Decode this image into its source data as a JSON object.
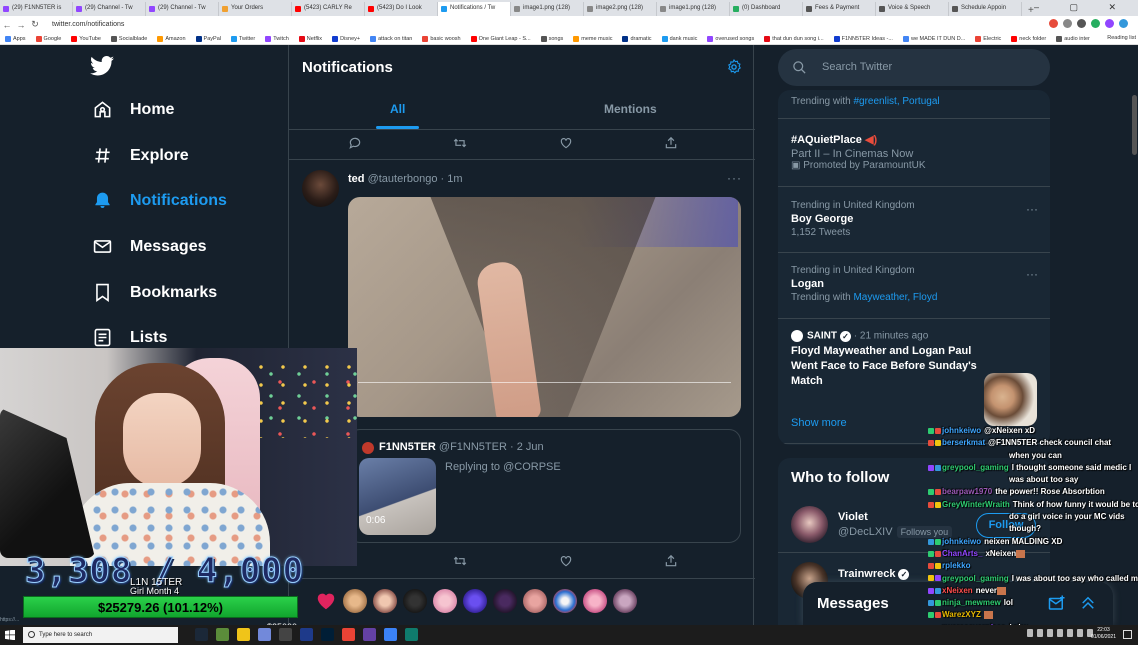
{
  "browser": {
    "tabs": [
      {
        "label": "(29) F1NN5TER is",
        "color": "#9146ff"
      },
      {
        "label": "(29) Channel - Tw",
        "color": "#9146ff"
      },
      {
        "label": "(29) Channel - Tw",
        "color": "#9146ff"
      },
      {
        "label": "Your Orders",
        "color": "#f0a030"
      },
      {
        "label": "(5423) CARLY Re",
        "color": "#ff0000"
      },
      {
        "label": "(5423) Do I Look",
        "color": "#ff0000"
      },
      {
        "label": "Notifications / Tw",
        "color": "#1d9bf0"
      },
      {
        "label": "image1.png (128)",
        "color": "#888888"
      },
      {
        "label": "image2.png (128)",
        "color": "#888888"
      },
      {
        "label": "image1.png (128)",
        "color": "#888888"
      },
      {
        "label": "(0) Dashboard",
        "color": "#27ae60"
      },
      {
        "label": "Fees & Payment",
        "color": "#555555"
      },
      {
        "label": "Voice & Speech",
        "color": "#555555"
      },
      {
        "label": "Schedule Appoin",
        "color": "#555555"
      }
    ],
    "url": "twitter.com/notifications",
    "bookmarks": [
      "Apps",
      "Google",
      "YouTube",
      "Socialblade",
      "Amazon",
      "PayPal",
      "Twitter",
      "Twitch",
      "Netflix",
      "Disney+",
      "attack on titan",
      "basic woosh",
      "One Giant Leap - S...",
      "songs",
      "meme music",
      "dramatic",
      "dank music",
      "overused songs",
      "that dun dun song i...",
      "F1NN5TER Ideas -...",
      "we MADE IT DUN D...",
      "Electric",
      "neck folder",
      "audio inter"
    ],
    "reading_list": "Reading list"
  },
  "sidebar": {
    "items": [
      {
        "label": "Home",
        "icon": "home-icon"
      },
      {
        "label": "Explore",
        "icon": "hashtag-icon"
      },
      {
        "label": "Notifications",
        "icon": "bell-icon",
        "active": true
      },
      {
        "label": "Messages",
        "icon": "envelope-icon"
      },
      {
        "label": "Bookmarks",
        "icon": "bookmark-icon"
      },
      {
        "label": "Lists",
        "icon": "list-icon"
      }
    ]
  },
  "main": {
    "title": "Notifications",
    "tabs": [
      {
        "label": "All"
      },
      {
        "label": "Mentions"
      }
    ],
    "tweet": {
      "name": "ted",
      "handle": "@tauterbongo",
      "time": "· 1m",
      "more": "···"
    },
    "quote": {
      "name": "F1NN5TER",
      "handle": "@F1NN5TER",
      "time": "· 2 Jun",
      "reply": "Replying to @CORPSE",
      "duration": "0:06"
    }
  },
  "right": {
    "search_placeholder": "Search Twitter",
    "trends": [
      {
        "context": "Trending with",
        "links": "#greenlist, Portugal"
      },
      {
        "title": "#AQuietPlace",
        "sub": "Part II – In Cinemas Now",
        "promo": "Promoted by ParamountUK"
      },
      {
        "context": "Trending in United Kingdom",
        "title": "Boy George",
        "sub": "1,152 Tweets"
      },
      {
        "context": "Trending in United Kingdom",
        "title": "Logan",
        "with_label": "Trending with",
        "links": "Mayweather, Floyd"
      }
    ],
    "news": {
      "source": "SAINT",
      "time": "· 21 minutes ago",
      "headline": "Floyd Mayweather and Logan Paul Went Face to Face Before Sunday's Match"
    },
    "show_more": "Show more",
    "who_to_follow": {
      "title": "Who to follow",
      "users": [
        {
          "name": "Violet",
          "handle": "@DecLXIV",
          "follows_you": "Follows you",
          "button": "Follow"
        },
        {
          "name": "Trainwreck",
          "handle": ""
        }
      ]
    },
    "messages_label": "Messages"
  },
  "stream": {
    "sub_count": "3,308 / 4,000",
    "sub_label_1": "L1N 15TER",
    "sub_label_2": "Girl Month 4",
    "donation": "$25279.26 (101.12%)",
    "donation_progress": 1.0112,
    "donation_goal": "$25000",
    "overflow_label": "https://..."
  },
  "chat": [
    {
      "user": "johnkeiwo",
      "color": "#3ea6ff",
      "msg": "@xNeixen xD"
    },
    {
      "user": "berserkmat",
      "color": "#3ea6ff",
      "msg": "@F1NN5TER check council chat"
    },
    {
      "user": "",
      "color": "#fff",
      "msg": "when you can"
    },
    {
      "user": "greypool_gaming",
      "color": "#2ecc71",
      "msg": "I thought someone said medic I"
    },
    {
      "user": "",
      "color": "#fff",
      "msg": "was about too say"
    },
    {
      "user": "bearpaw1970",
      "color": "#9b59b6",
      "msg": "the power!! Rose Absorbtion"
    },
    {
      "user": "GreyWinterWraith",
      "color": "#2ecc71",
      "msg": "Think of how funny it would be to"
    },
    {
      "user": "",
      "color": "#fff",
      "msg": "do a girl voice in your MC vids"
    },
    {
      "user": "",
      "color": "#fff",
      "msg": "though?"
    },
    {
      "user": "johnkeiwo",
      "color": "#3ea6ff",
      "msg": "neixen MALDING XD"
    },
    {
      "user": "ChanArts_",
      "color": "#9146ff",
      "msg": "xNeixen"
    },
    {
      "user": "rplekko",
      "color": "#3ea6ff",
      "msg": ""
    },
    {
      "user": "greypool_gaming",
      "color": "#2ecc71",
      "msg": "I was about too say who called me"
    },
    {
      "user": "xNeixen",
      "color": "#ff4d4d",
      "msg": "never"
    },
    {
      "user": "ninja_mewmew",
      "color": "#2ecc71",
      "msg": "lol"
    },
    {
      "user": "WarezXYZ",
      "color": "#e6b800",
      "msg": ""
    },
    {
      "user": "qwerassyerplaes",
      "color": "#9146ff",
      "msg": "kekw"
    }
  ],
  "taskbar": {
    "search_placeholder": "Type here to search",
    "time": "22:03",
    "date": "01/06/2021"
  }
}
